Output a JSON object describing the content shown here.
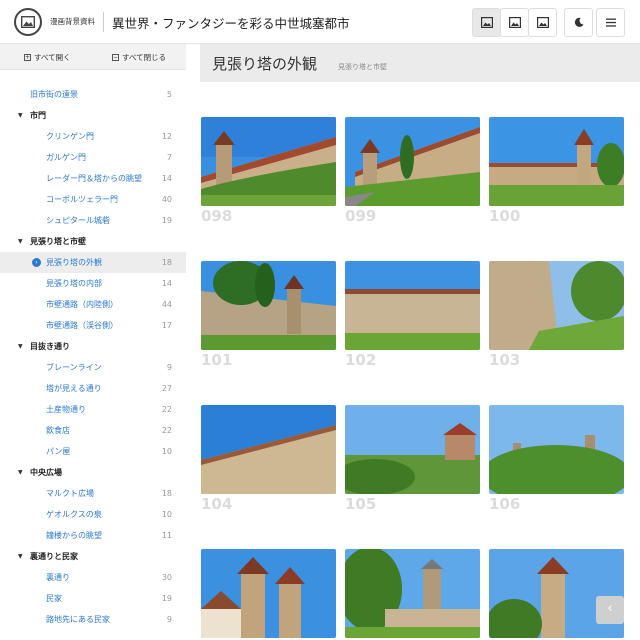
{
  "header": {
    "brand": "漫画背景資料",
    "title": "異世界・ファンタジーを彩る中世城塞都市"
  },
  "sidebar": {
    "expand_all": "すべて開く",
    "collapse_all": "すべて閉じる",
    "items": [
      {
        "label": "旧市街の遠景",
        "count": "5"
      },
      {
        "label": "市門",
        "count": ""
      },
      {
        "label": "クリンゲン門",
        "count": "12"
      },
      {
        "label": "ガルゲン門",
        "count": "7"
      },
      {
        "label": "レーダー門＆塔からの眺望",
        "count": "14"
      },
      {
        "label": "コーボルツェラー門",
        "count": "40"
      },
      {
        "label": "シュピタール城砦",
        "count": "19"
      },
      {
        "label": "見張り塔と市壁",
        "count": ""
      },
      {
        "label": "見張り塔の外観",
        "count": "18"
      },
      {
        "label": "見張り塔の内部",
        "count": "14"
      },
      {
        "label": "市壁通路（内陸側）",
        "count": "44"
      },
      {
        "label": "市壁通路（渓谷側）",
        "count": "17"
      },
      {
        "label": "目抜き通り",
        "count": ""
      },
      {
        "label": "ブレーンライン",
        "count": "9"
      },
      {
        "label": "塔が見える通り",
        "count": "27"
      },
      {
        "label": "土産物通り",
        "count": "22"
      },
      {
        "label": "飲食店",
        "count": "22"
      },
      {
        "label": "パン屋",
        "count": "10"
      },
      {
        "label": "中央広場",
        "count": ""
      },
      {
        "label": "マルクト広場",
        "count": "18"
      },
      {
        "label": "ゲオルクスの泉",
        "count": "10"
      },
      {
        "label": "鐘楼からの眺望",
        "count": "11"
      },
      {
        "label": "裏通りと民家",
        "count": ""
      },
      {
        "label": "裏通り",
        "count": "30"
      },
      {
        "label": "民家",
        "count": "19"
      },
      {
        "label": "路地先にある民家",
        "count": "9"
      }
    ]
  },
  "main": {
    "title": "見張り塔の外観",
    "breadcrumb": "見張り塔と市壁",
    "photos": [
      "098",
      "099",
      "100",
      "101",
      "102",
      "103",
      "104",
      "105",
      "106",
      "",
      "",
      ""
    ]
  },
  "scroll_button": "‹",
  "colors": {
    "link": "#2a7ad4",
    "titlebar": "#ebebeb",
    "number": "#dcdcdc"
  },
  "icons": [
    "image-icon",
    "image-icon",
    "image-icon",
    "moon-icon",
    "menu-icon"
  ]
}
